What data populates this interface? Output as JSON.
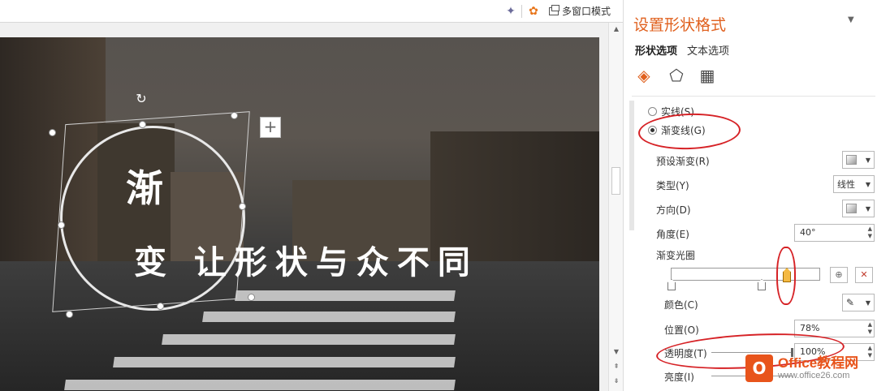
{
  "toolbar": {
    "multi_window_label": "多窗口模式",
    "pin_icon": "pin-icon",
    "gear_icon": "gear-icon"
  },
  "slide": {
    "heading": "渐",
    "subtitle": "变 让形状与众不同"
  },
  "panel": {
    "title": "设置形状格式",
    "tabs": [
      {
        "label": "形状选项",
        "active": true
      },
      {
        "label": "文本选项",
        "active": false
      }
    ],
    "categories": [
      "fill-line-icon",
      "effects-icon",
      "size-properties-icon"
    ],
    "line_options": {
      "solid_label": "实线(S)",
      "gradient_label": "渐变线(G)",
      "selected": "gradient"
    },
    "preset_gradient_label": "预设渐变(R)",
    "type_label": "类型(Y)",
    "type_value": "线性",
    "direction_label": "方向(D)",
    "angle_label": "角度(E)",
    "angle_value": "40°",
    "gradient_stops_label": "渐变光圈",
    "color_label": "颜色(C)",
    "position_label": "位置(O)",
    "position_value": "78%",
    "transparency_label": "透明度(T)",
    "transparency_value": "100%",
    "brightness_label": "亮度(I)"
  },
  "watermark": {
    "main": "Office教程网",
    "sub": "www.office26.com"
  },
  "colors": {
    "accent": "#e0611f",
    "annotation": "#d62226",
    "selected_stop": "#f4b942"
  }
}
